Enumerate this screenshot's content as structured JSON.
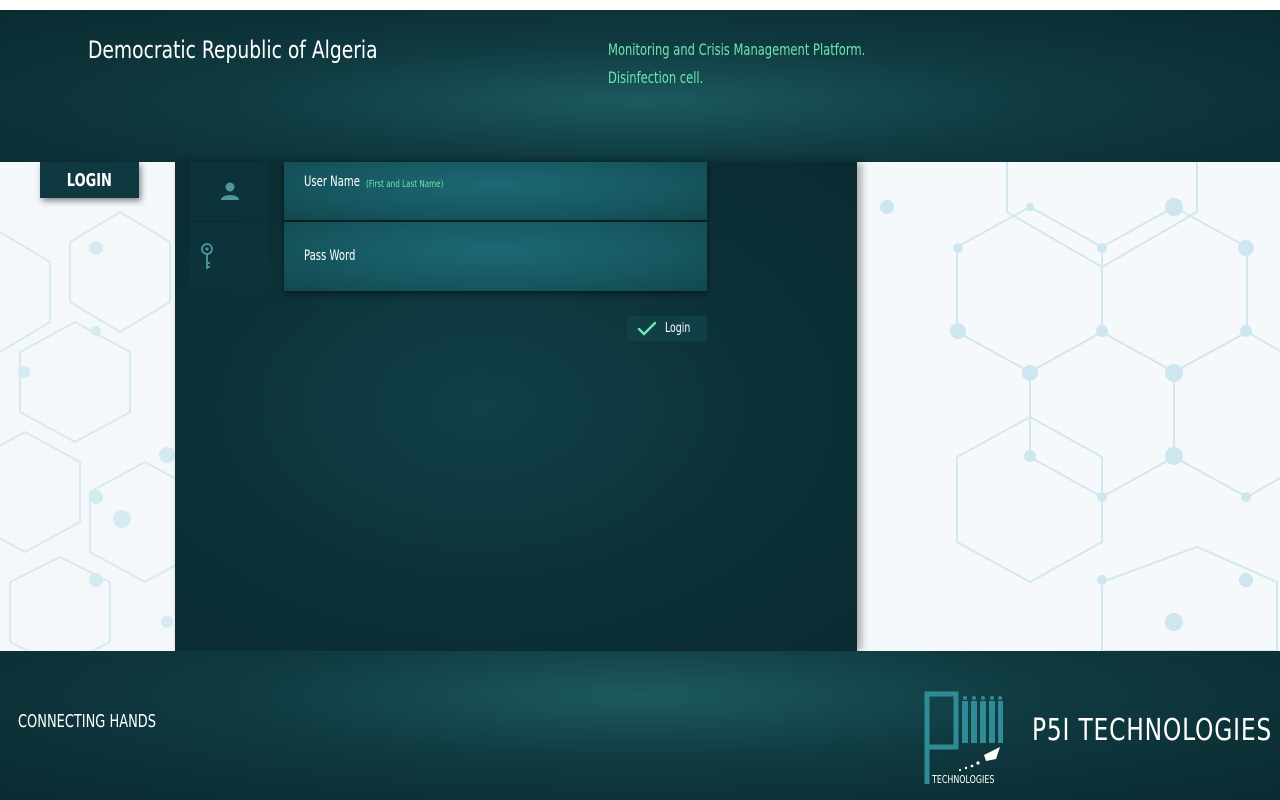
{
  "header": {
    "title": "Democratic Republic of Algeria",
    "platform_line1": "Monitoring and Crisis Management Platform.",
    "platform_line2": "Disinfection cell."
  },
  "login_tab": {
    "label": "LOGIN"
  },
  "form": {
    "username": {
      "label": "User Name",
      "hint": "(First and Last Name)",
      "icon": "user-icon"
    },
    "password": {
      "label": "Pass Word",
      "icon": "key-icon"
    },
    "submit": {
      "label": "Login",
      "icon": "check-icon"
    }
  },
  "footer": {
    "tagline": "CONNECTING HANDS",
    "logo_text": "TECHNOLOGIES",
    "brand": "P5I TECHNOLOGIES"
  },
  "colors": {
    "accent_green": "#6ee6b0",
    "panel_dark": "#0c3137",
    "field_teal": "#165760"
  }
}
